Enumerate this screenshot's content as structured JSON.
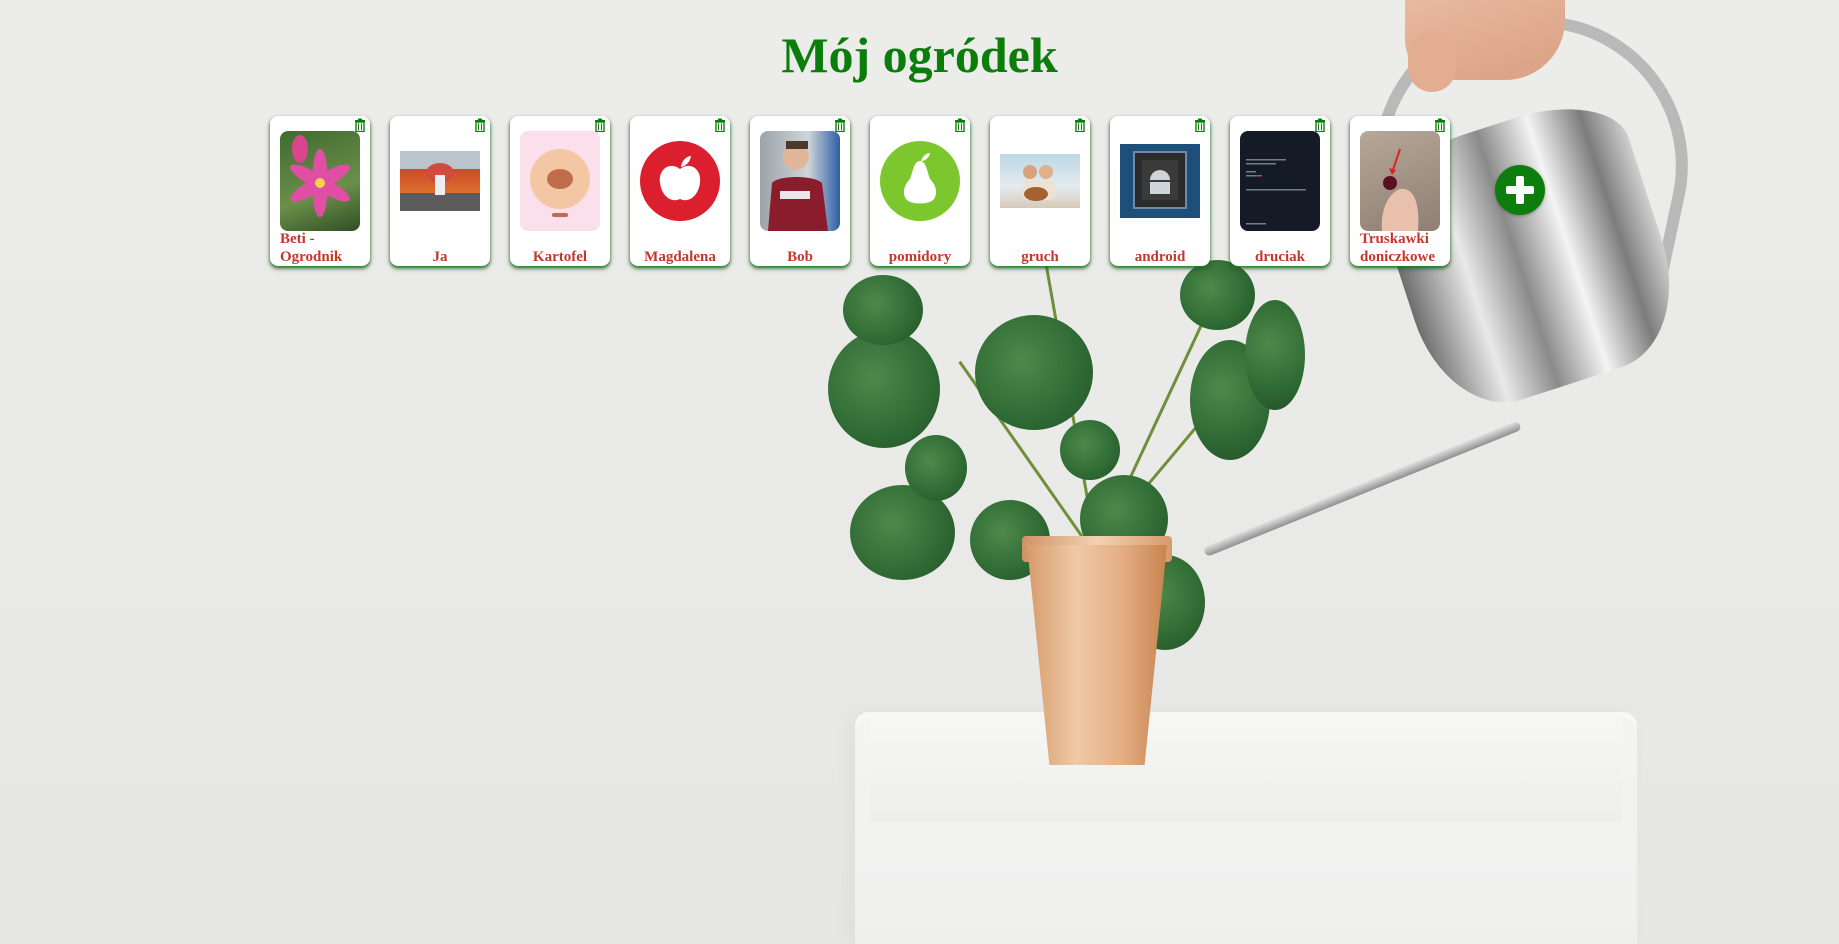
{
  "title": "Mój ogródek",
  "gardens": [
    {
      "label": "Beti - Ogrodnik",
      "thumb_icon": "pink-lily-photo"
    },
    {
      "label": "Ja",
      "thumb_icon": "mushroom-photo"
    },
    {
      "label": "Kartofel",
      "thumb_icon": "potato-app-icon"
    },
    {
      "label": "Magdalena",
      "thumb_icon": "apple-icon"
    },
    {
      "label": "Bob",
      "thumb_icon": "man-portrait-photo"
    },
    {
      "label": "pomidory",
      "thumb_icon": "pear-icon"
    },
    {
      "label": "gruch",
      "thumb_icon": "couple-guitar-photo"
    },
    {
      "label": "android",
      "thumb_icon": "android-chip-icon"
    },
    {
      "label": "druciak",
      "thumb_icon": "terminal-screenshot"
    },
    {
      "label": "Truskawki doniczkowe",
      "thumb_icon": "strawberry-hand-photo"
    }
  ],
  "delete_icon": "trash-icon",
  "add_icon": "plus-circle-icon",
  "colors": {
    "title": "#0a7d0a",
    "label": "#c0392b",
    "accent": "#0d7d0d"
  }
}
